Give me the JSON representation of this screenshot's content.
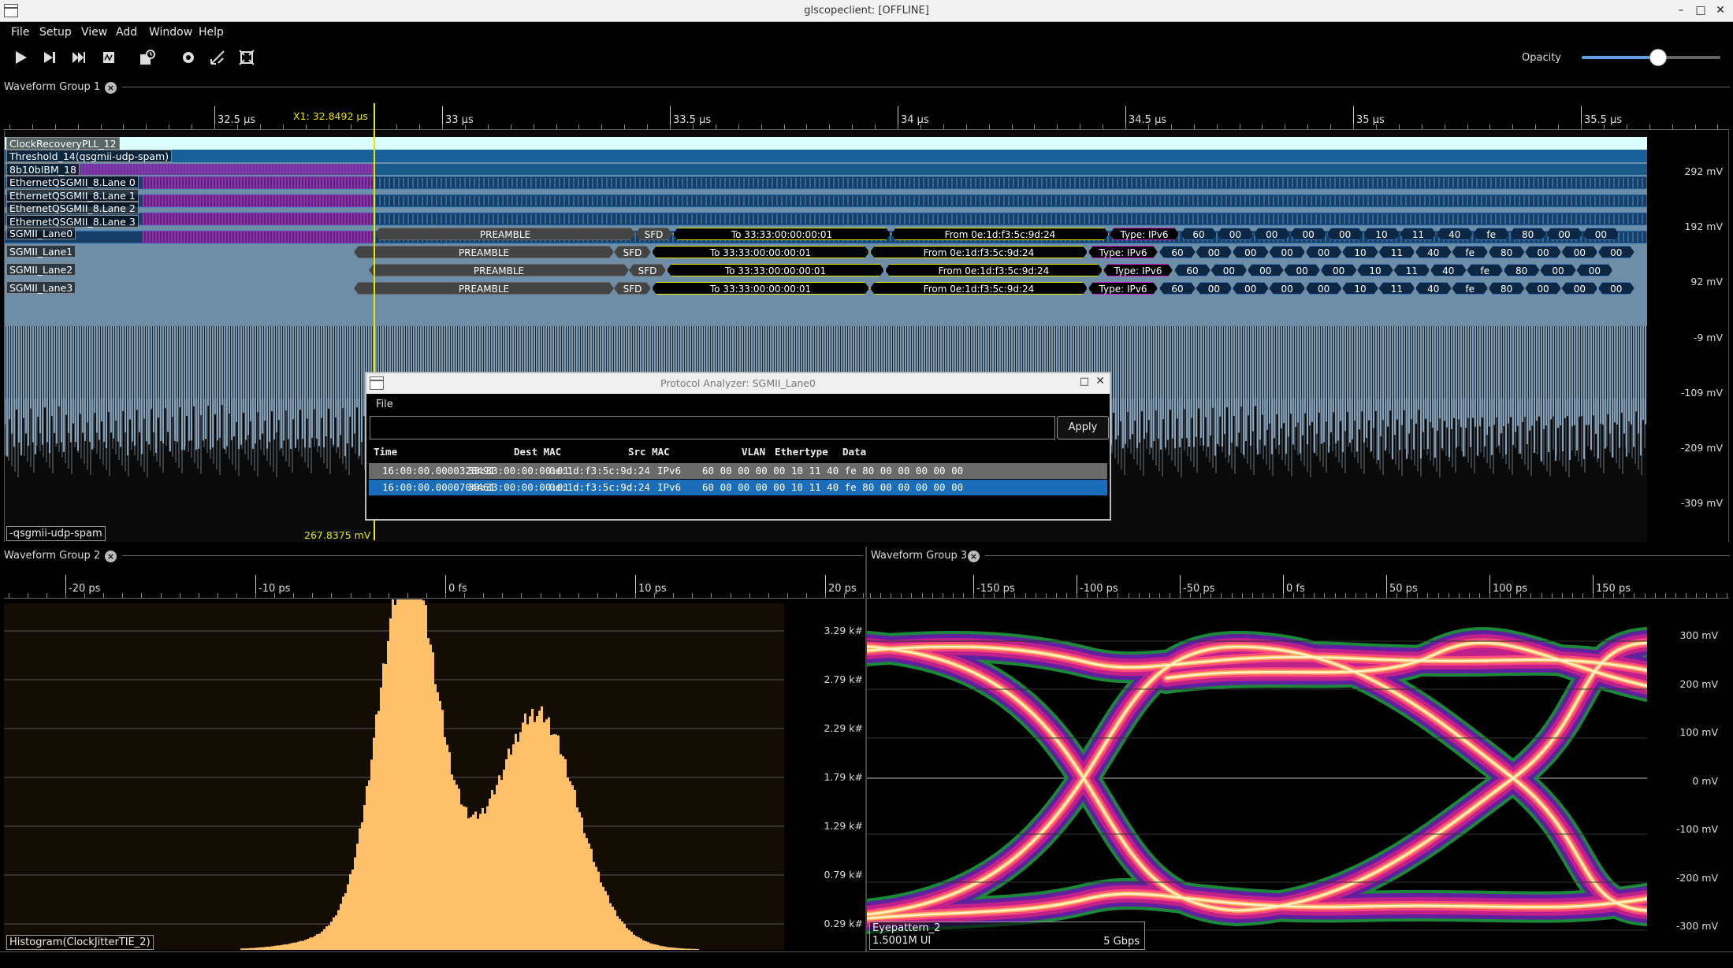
{
  "window": {
    "title": "glscopeclient: [OFFLINE]",
    "buttons": [
      "–",
      "□",
      "✕"
    ]
  },
  "menubar": [
    "File",
    "Setup",
    "View",
    "Add",
    "Window",
    "Help"
  ],
  "toolbar": {
    "opacity_label": "Opacity",
    "opacity_value": 0.55,
    "icons": [
      "run-icon",
      "single-trigger-icon",
      "force-trigger-icon",
      "stop-icon",
      "history-icon",
      "settings-icon",
      "fullscreen-icon",
      "zoom-fit-icon"
    ]
  },
  "group1": {
    "title": "Waveform Group 1",
    "ticks": [
      "32.5 µs",
      "33 µs",
      "33.5 µs",
      "34 µs",
      "34.5 µs",
      "35 µs",
      "35.5 µs"
    ],
    "cursor": "X1: 32.8492 µs",
    "cursor_value": "267.8375 mV",
    "digital_channels": [
      "ClockRecoveryPLL_12",
      "Threshold_14(qsgmii-udp-spam)",
      "8b10bIBM_18",
      "EthernetQSGMII_8.Lane 0",
      "EthernetQSGMII_8.Lane 1",
      "EthernetQSGMII_8.Lane 2",
      "EthernetQSGMII_8.Lane 3"
    ],
    "lanes": [
      {
        "name": "SGMII_Lane0",
        "preamble": "PREAMBLE",
        "sfd": "SFD",
        "dest": "To 33:33:00:00:00:01",
        "src": "From 0e:1d:f3:5c:9d:24",
        "type": "Type: IPv6",
        "bytes": [
          "60",
          "00",
          "00",
          "00",
          "00",
          "10",
          "11",
          "40",
          "fe",
          "80",
          "00",
          "00",
          "00"
        ]
      },
      {
        "name": "SGMII_Lane1",
        "preamble": "PREAMBLE",
        "sfd": "SFD",
        "dest": "To 33:33:00:00:00:01",
        "src": "From 0e:1d:f3:5c:9d:24",
        "type": "Type: IPv6",
        "bytes": [
          "60",
          "00",
          "00",
          "00",
          "00",
          "10",
          "11",
          "40",
          "fe",
          "80",
          "00",
          "00",
          "00"
        ]
      },
      {
        "name": "SGMII_Lane2",
        "preamble": "PREAMBLE",
        "sfd": "SFD",
        "dest": "To 33:33:00:00:00:01",
        "src": "From 0e:1d:f3:5c:9d:24",
        "type": "Type: IPv6",
        "bytes": [
          "60",
          "00",
          "00",
          "00",
          "00",
          "10",
          "11",
          "40",
          "fe",
          "80",
          "00",
          "00",
          "00"
        ]
      },
      {
        "name": "SGMII_Lane3",
        "preamble": "PREAMBLE",
        "sfd": "SFD",
        "dest": "To 33:33:00:00:00:01",
        "src": "From 0e:1d:f3:5c:9d:24",
        "type": "Type: IPv6",
        "bytes": [
          "60",
          "00",
          "00",
          "00",
          "00",
          "10",
          "11",
          "40",
          "fe",
          "80",
          "00",
          "00",
          "00"
        ]
      }
    ],
    "y_axis": [
      "292 mV",
      "192 mV",
      "92 mV",
      "-9 mV",
      "-109 mV",
      "-209 mV",
      "-309 mV"
    ],
    "analog_label": "-qsgmii-udp-spam"
  },
  "protocol_analyzer": {
    "title": "Protocol Analyzer: SGMII_Lane0",
    "menu": "File",
    "filter_placeholder": "",
    "apply_label": "Apply",
    "columns": [
      "Time",
      "Dest MAC",
      "Src MAC",
      "VLAN",
      "Ethertype",
      "Data"
    ],
    "rows": [
      {
        "time": "16:00:00.0000328491",
        "dest": "33:33:00:00:00:01",
        "src": "0e:1d:f3:5c:9d:24",
        "vlan": "",
        "ethertype": "IPv6",
        "data": "60 00 00 00 00 10 11 40 fe 80 00 00 00 00 00"
      },
      {
        "time": "16:00:00.0000704461",
        "dest": "33:33:00:00:00:01",
        "src": "0e:1d:f3:5c:9d:24",
        "vlan": "",
        "ethertype": "IPv6",
        "data": "60 00 00 00 00 10 11 40 fe 80 00 00 00 00 00"
      }
    ],
    "selected_row": 1
  },
  "group2": {
    "title": "Waveform Group 2",
    "ticks": [
      "-20 ps",
      "-10 ps",
      "0 fs",
      "10 ps",
      "20 ps"
    ],
    "y_axis": [
      "3.29 k#",
      "2.79 k#",
      "2.29 k#",
      "1.79 k#",
      "1.29 k#",
      "0.79 k#",
      "0.29 k#"
    ],
    "label": "Histogram(ClockJitterTIE_2)",
    "color": "#ffc06a"
  },
  "group3": {
    "title": "Waveform Group 3",
    "ticks": [
      "-150 ps",
      "-100 ps",
      "-50 ps",
      "0 fs",
      "50 ps",
      "100 ps",
      "150 ps"
    ],
    "y_axis": [
      "300 mV",
      "200 mV",
      "100 mV",
      "0 mV",
      "-100 mV",
      "-200 mV",
      "-300 mV"
    ],
    "label": "Eyepattern_2",
    "ui_count": "1.5001M UI",
    "rate": "5 Gbps"
  }
}
